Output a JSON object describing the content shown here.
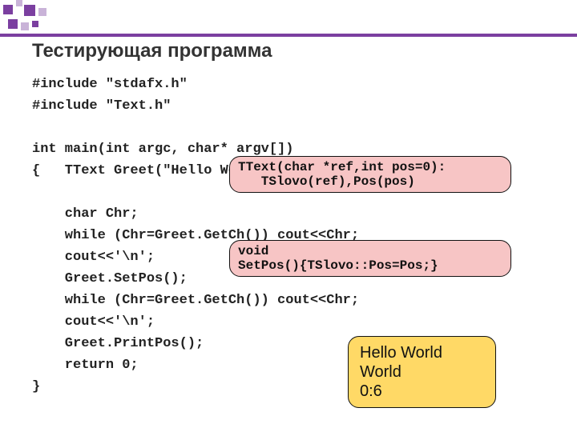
{
  "title": "Тестирующая программа",
  "code": {
    "l1": "#include \"stdafx.h\"",
    "l2": "#include \"Text.h\"",
    "l3": "",
    "l4": "int main(int argc, char* argv[])",
    "l5": "{   TText Greet(\"Hello World\",6);",
    "l6": "",
    "l7": "    char Chr;",
    "l8": "    while (Chr=Greet.GetCh()) cout<<Chr;",
    "l9": "    cout<<'\\n';",
    "l10": "    Greet.SetPos();",
    "l11": "    while (Chr=Greet.GetCh()) cout<<Chr;",
    "l12": "    cout<<'\\n';",
    "l13": "    Greet.PrintPos();",
    "l14": "    return 0;",
    "l15": "}"
  },
  "annot1": "TText(char *ref,int pos=0):\n   TSlovo(ref),Pos(pos)",
  "annot2": "void\nSetPos(){TSlovo::Pos=Pos;}",
  "output": {
    "l1": "Hello World",
    "l2": "World",
    "l3": "0:6"
  }
}
